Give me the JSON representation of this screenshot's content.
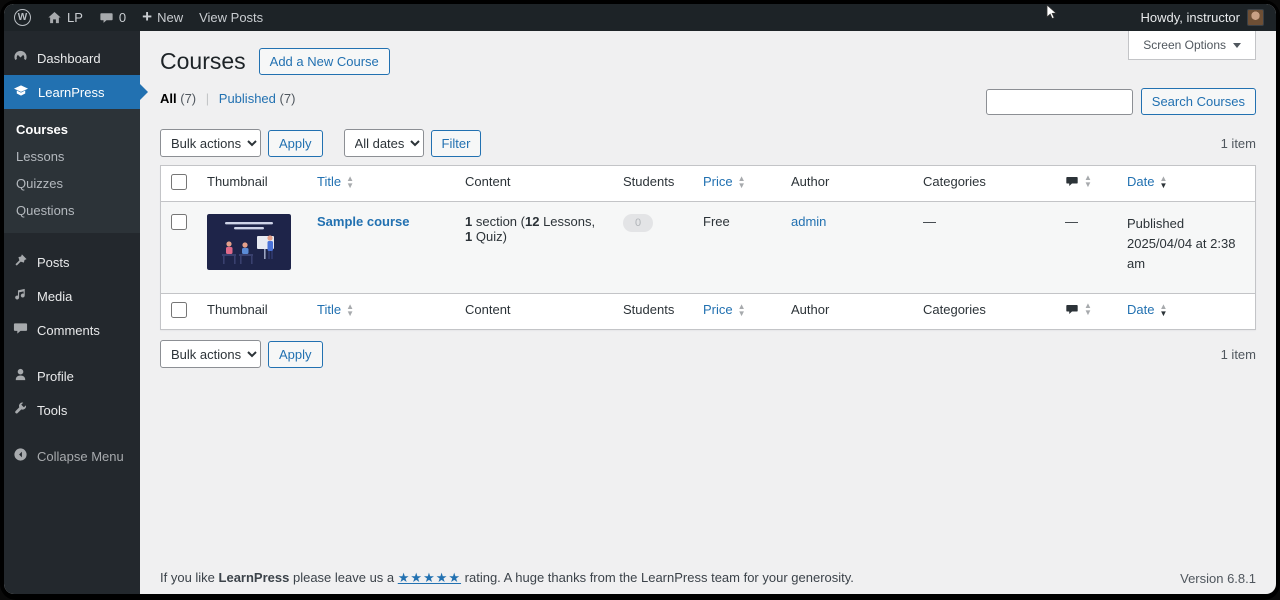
{
  "colors": {
    "accent": "#2271b1",
    "admin_bar_bg": "#1d2327",
    "menu_bg": "#23282d",
    "submenu_bg": "#2c3338",
    "content_bg": "#f0f0f1",
    "row_bg": "#f6f7f7"
  },
  "admin_bar": {
    "wp_logo": "W",
    "site_name": "LP",
    "comment_count": "0",
    "new_label": "New",
    "view_posts_label": "View Posts",
    "howdy_label": "Howdy, instructor"
  },
  "screen_options": {
    "label": "Screen Options"
  },
  "sidebar": {
    "items": [
      {
        "label": "Dashboard"
      },
      {
        "label": "LearnPress"
      },
      {
        "label": "Posts"
      },
      {
        "label": "Media"
      },
      {
        "label": "Comments"
      },
      {
        "label": "Profile"
      },
      {
        "label": "Tools"
      },
      {
        "label": "Collapse Menu"
      }
    ],
    "learnpress_submenu": [
      {
        "label": "Courses"
      },
      {
        "label": "Lessons"
      },
      {
        "label": "Quizzes"
      },
      {
        "label": "Questions"
      }
    ]
  },
  "page": {
    "title": "Courses",
    "add_new_label": "Add a New Course"
  },
  "views": {
    "all_label": "All",
    "all_count": "(7)",
    "separator": "|",
    "published_label": "Published",
    "published_count": "(7)"
  },
  "search": {
    "input_value": "",
    "button_label": "Search Courses"
  },
  "tablenav": {
    "bulk_actions_label": "Bulk actions",
    "apply_label": "Apply",
    "all_dates_label": "All dates",
    "filter_label": "Filter",
    "item_count": "1 item"
  },
  "table": {
    "headers": {
      "thumbnail": "Thumbnail",
      "title": "Title",
      "content": "Content",
      "students": "Students",
      "price": "Price",
      "author": "Author",
      "categories": "Categories",
      "date": "Date"
    },
    "row": {
      "title": "Sample course",
      "content_num1": "1",
      "content_text1": " section (",
      "content_num2": "12",
      "content_text2": " Lessons, ",
      "content_num3": "1",
      "content_text3": " Quiz)",
      "students_count": "0",
      "price": "Free",
      "author": "admin",
      "categories": "—",
      "comments": "—",
      "date_status": "Published",
      "date_value": "2025/04/04 at 2:38 am"
    }
  },
  "footer": {
    "like_prefix": "If you like ",
    "brand": "LearnPress",
    "like_mid": " please leave us a ",
    "stars": "★★★★★",
    "like_suffix": " rating. A huge thanks from the LearnPress team for your generosity.",
    "version": "Version 6.8.1"
  }
}
